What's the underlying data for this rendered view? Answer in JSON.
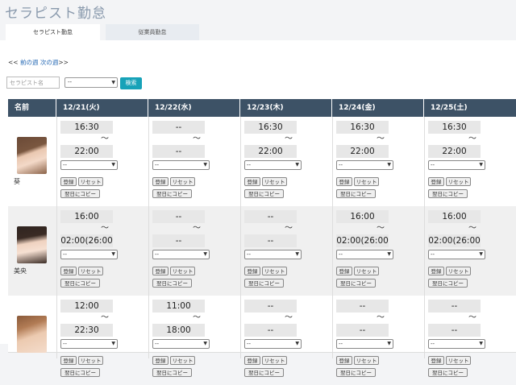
{
  "page_title": "セラピスト勤怠",
  "tabs": [
    {
      "label": "セラピスト勤怠"
    },
    {
      "label": "従業員勤怠"
    }
  ],
  "week_nav": {
    "prev_prefix": "<<",
    "prev": "前の週",
    "next": "次の週",
    "next_suffix": ">>"
  },
  "search": {
    "placeholder": "セラピスト名",
    "filter_value": "--",
    "button": "検索"
  },
  "table": {
    "headers": [
      "名前",
      "12/21(火)",
      "12/22(水)",
      "12/23(木)",
      "12/24(金)",
      "12/25(土)"
    ],
    "tilde": "～",
    "select_value": "--",
    "buttons": {
      "register": "登録",
      "reset": "リセット",
      "copy": "翌日にコピー"
    },
    "rows": [
      {
        "name": "葵",
        "shifts": [
          {
            "start": "16:30",
            "end": "22:00"
          },
          {
            "start": "--",
            "end": "--"
          },
          {
            "start": "16:30",
            "end": "22:00"
          },
          {
            "start": "16:30",
            "end": "22:00"
          },
          {
            "start": "16:30",
            "end": "22:00"
          }
        ]
      },
      {
        "name": "美央",
        "shifts": [
          {
            "start": "16:00",
            "end": "02:00(26:00"
          },
          {
            "start": "--",
            "end": "--"
          },
          {
            "start": "--",
            "end": "--"
          },
          {
            "start": "16:00",
            "end": "02:00(26:00"
          },
          {
            "start": "16:00",
            "end": "02:00(26:00"
          }
        ]
      },
      {
        "name": "",
        "shifts": [
          {
            "start": "12:00",
            "end": "22:30"
          },
          {
            "start": "11:00",
            "end": "18:00"
          },
          {
            "start": "--",
            "end": "--"
          },
          {
            "start": "--",
            "end": "--"
          },
          {
            "start": "--",
            "end": "--"
          }
        ]
      }
    ]
  },
  "colors": {
    "header_bg": "#3d5266",
    "search_button": "#17a2b8",
    "link": "#2468b4"
  }
}
